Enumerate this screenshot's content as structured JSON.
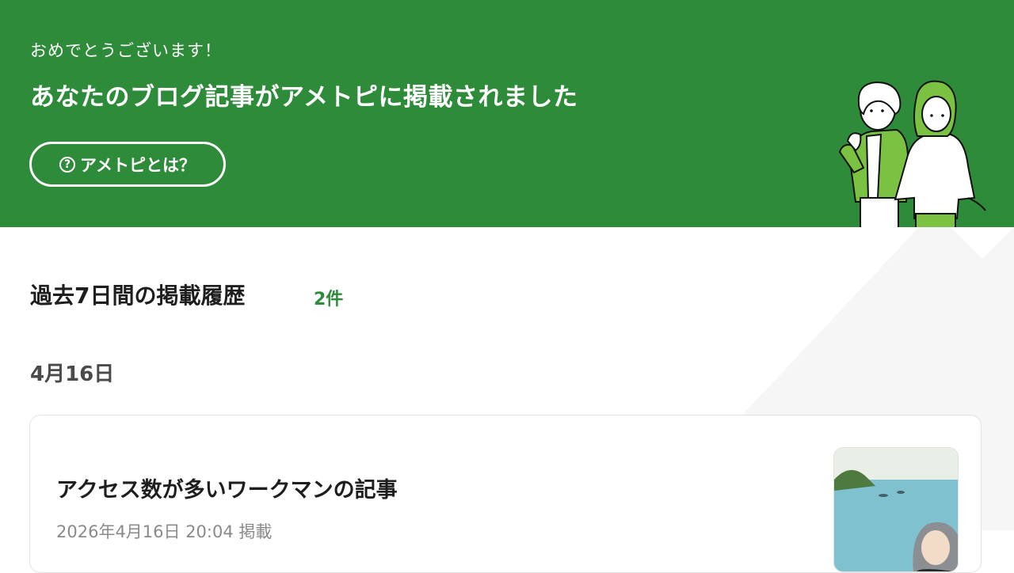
{
  "hero": {
    "congrats_text": "おめでとうございます！",
    "headline": "あなたのブログ記事がアメトピに掲載されました",
    "about_button_label": "アメトピとは？",
    "about_icon_glyph": "?",
    "bg_color": "#2e8b3a"
  },
  "history": {
    "title": "過去7日間の掲載履歴",
    "count": "2件",
    "date_heading": "4月16日",
    "articles": [
      {
        "title": "アクセス数が多いワークマンの記事",
        "meta": "2026年4月16日 20:04 掲載"
      }
    ]
  },
  "colors": {
    "accent": "#2e8b3a",
    "illustration_green": "#7cc242"
  }
}
